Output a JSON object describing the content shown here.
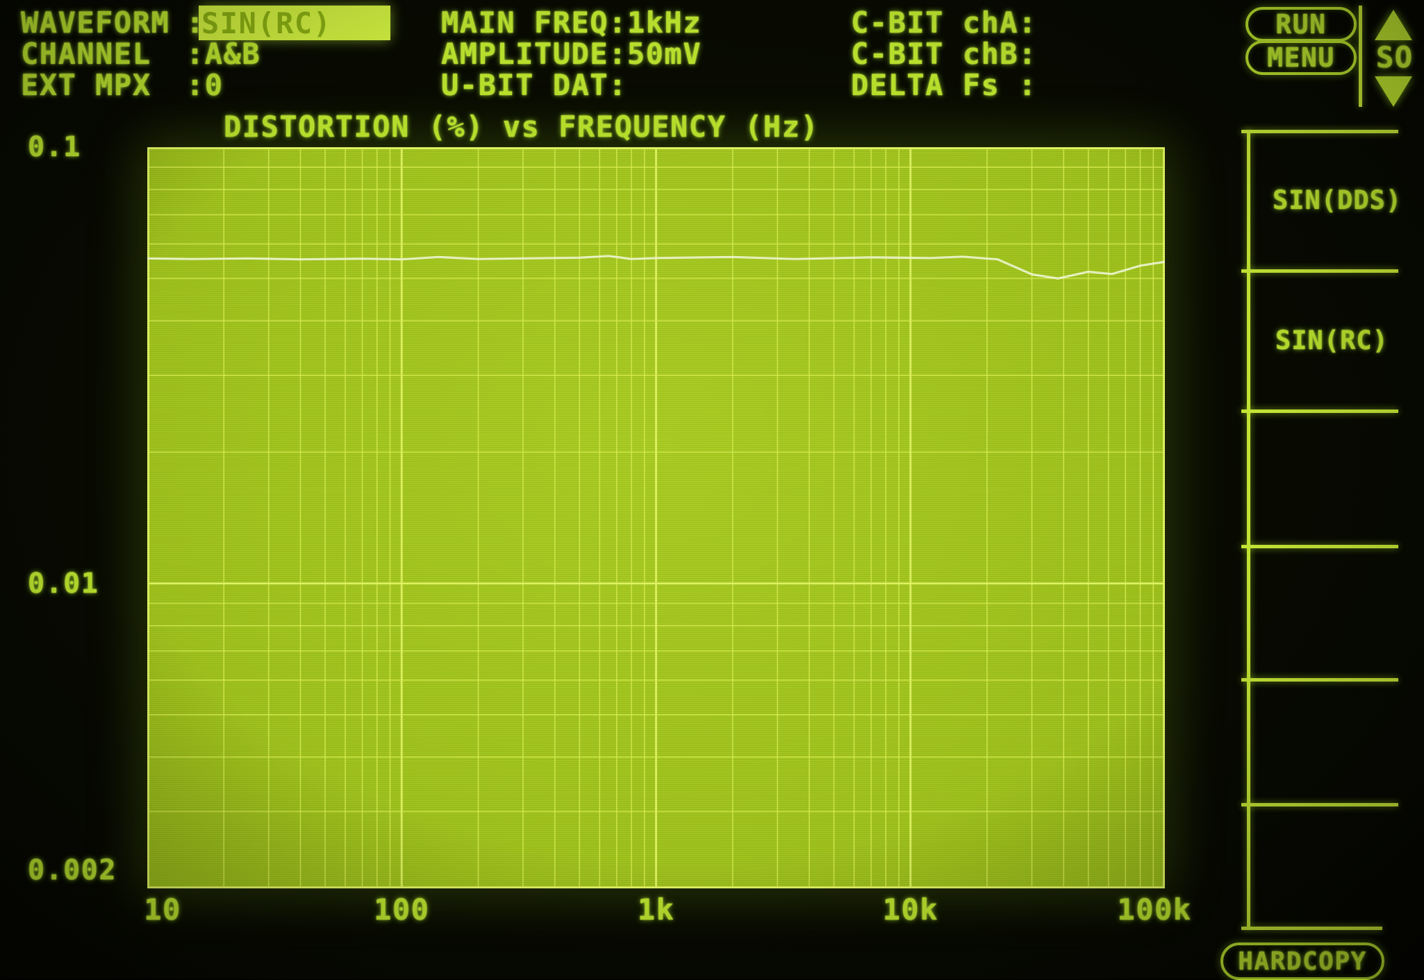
{
  "header": {
    "left": [
      {
        "label": "WAVEFORM",
        "colon": ":",
        "value": "SIN(RC)"
      },
      {
        "label": "CHANNEL",
        "colon_value": ":A&B"
      },
      {
        "label": "EXT MPX",
        "colon_value": ":0"
      }
    ],
    "mid": [
      {
        "text": "MAIN FREQ:1kHz"
      },
      {
        "text": "AMPLITUDE:50mV"
      },
      {
        "text": "U-BIT DAT:"
      }
    ],
    "right": [
      {
        "text": "C-BIT chA:"
      },
      {
        "text": "C-BIT chB:"
      },
      {
        "text": "DELTA Fs :"
      }
    ]
  },
  "controls": {
    "run_label": "RUN",
    "menu_label": "MENU",
    "selector_label": "SO",
    "hardcopy_label": "HARDCOPY"
  },
  "softkeys": {
    "items": [
      {
        "label": "SIN(DDS)"
      },
      {
        "label": "SIN(RC)"
      },
      {
        "label": ""
      },
      {
        "label": ""
      },
      {
        "label": ""
      },
      {
        "label": ""
      }
    ]
  },
  "chart_data": {
    "type": "line",
    "title": "DISTORTION (%) vs FREQUENCY (Hz)",
    "xlabel": "FREQUENCY (Hz)",
    "ylabel": "DISTORTION (%)",
    "x_scale": "log",
    "y_scale": "log",
    "xlim": [
      10,
      100000
    ],
    "ylim": [
      0.002,
      0.1
    ],
    "grid": "log-log minor+major, bright lines on green field",
    "x_ticks": [
      {
        "value": 10,
        "label": "10"
      },
      {
        "value": 100,
        "label": "100"
      },
      {
        "value": 1000,
        "label": "1k"
      },
      {
        "value": 10000,
        "label": "10k"
      },
      {
        "value": 100000,
        "label": "100k"
      }
    ],
    "y_ticks": [
      {
        "value": 0.1,
        "label": "0.1"
      },
      {
        "value": 0.01,
        "label": "0.01"
      },
      {
        "value": 0.002,
        "label": "0.002"
      }
    ],
    "series": [
      {
        "name": "distortion-trace",
        "points": [
          [
            10,
            0.0556
          ],
          [
            15,
            0.0554
          ],
          [
            25,
            0.0556
          ],
          [
            40,
            0.0553
          ],
          [
            70,
            0.0555
          ],
          [
            100,
            0.0553
          ],
          [
            140,
            0.056
          ],
          [
            200,
            0.0554
          ],
          [
            300,
            0.0556
          ],
          [
            500,
            0.0558
          ],
          [
            650,
            0.0563
          ],
          [
            800,
            0.0554
          ],
          [
            1000,
            0.0557
          ],
          [
            2000,
            0.056
          ],
          [
            3500,
            0.0554
          ],
          [
            7000,
            0.0559
          ],
          [
            12000,
            0.0557
          ],
          [
            16000,
            0.0561
          ],
          [
            22000,
            0.0553
          ],
          [
            30000,
            0.0511
          ],
          [
            38000,
            0.05
          ],
          [
            50000,
            0.0518
          ],
          [
            62000,
            0.0512
          ],
          [
            80000,
            0.0535
          ],
          [
            100000,
            0.0546
          ]
        ]
      }
    ]
  },
  "colors": {
    "text": "#b8de2d",
    "highlight_box": "#cbe93e",
    "highlight_text": "#86aa12",
    "plot_background": "#a3c51f",
    "grid_minor": "#dcf055",
    "grid_major": "#e2f464",
    "trace": "#eff8cf",
    "screen_background": "#080a02"
  }
}
